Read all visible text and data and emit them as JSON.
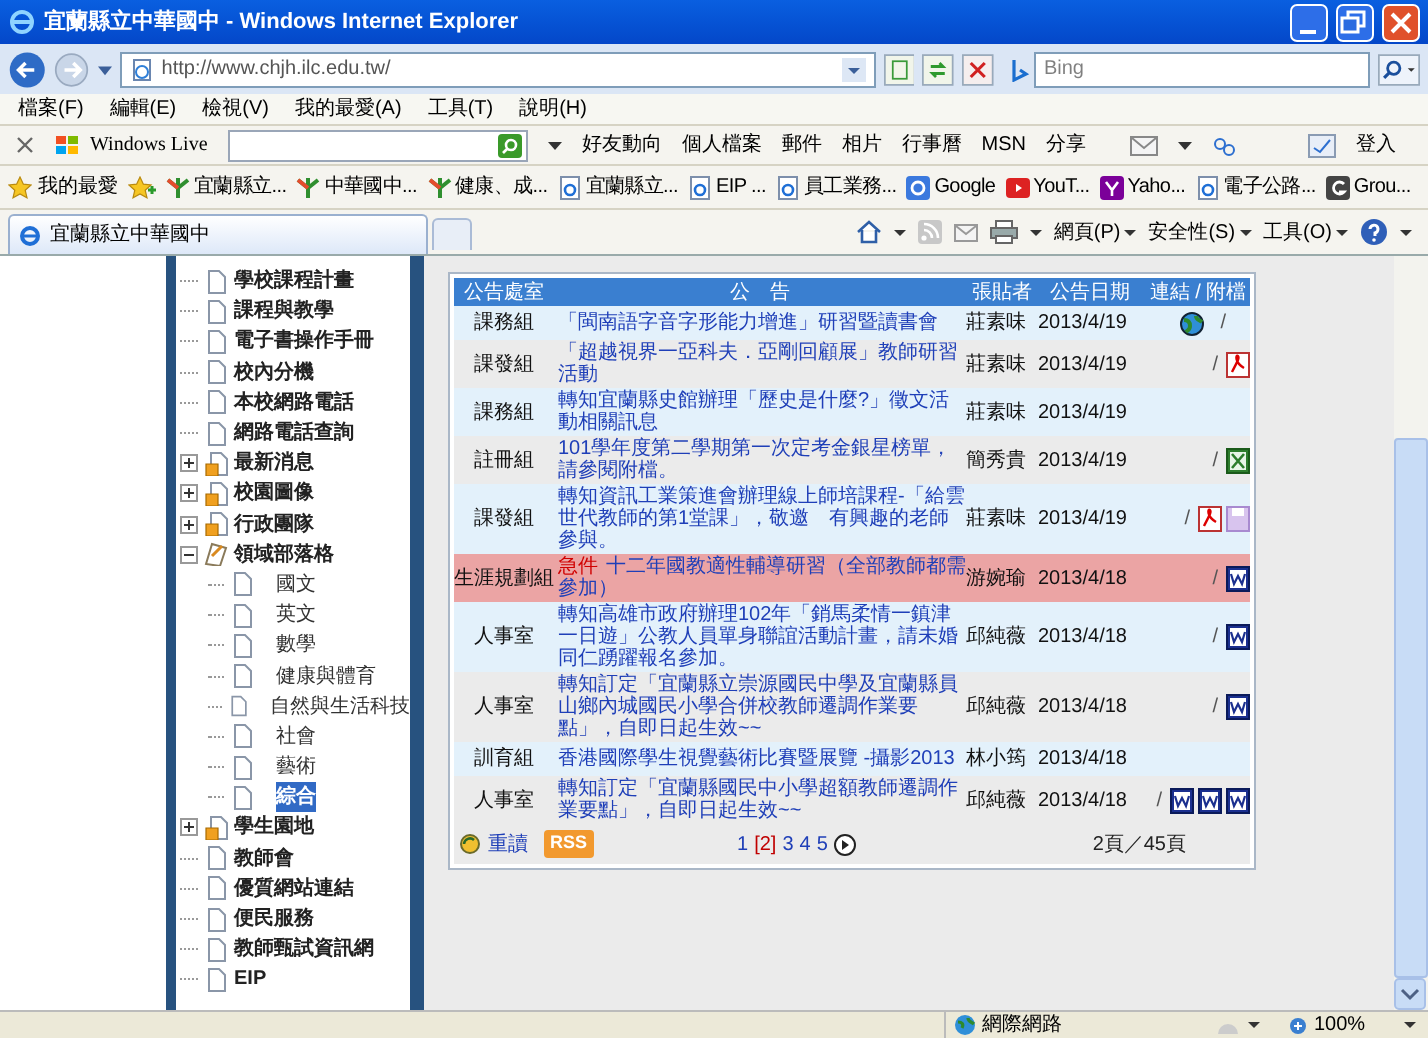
{
  "window": {
    "title": "宜蘭縣立中華國中 - Windows Internet Explorer"
  },
  "address_bar": {
    "url": "http://www.chjh.ilc.edu.tw/",
    "search_placeholder": "Bing"
  },
  "menu": [
    "檔案(F)",
    "編輯(E)",
    "檢視(V)",
    "我的最愛(A)",
    "工具(T)",
    "說明(H)"
  ],
  "live_toolbar": {
    "brand": "Windows Live",
    "links": [
      "好友動向",
      "個人檔案",
      "郵件",
      "相片",
      "行事曆",
      "MSN",
      "分享"
    ],
    "sign_in": "登入"
  },
  "favorites_bar": {
    "label": "我的最愛",
    "items": [
      {
        "label": "宜蘭縣立...",
        "kind": "leaf"
      },
      {
        "label": "中華國中...",
        "kind": "leaf"
      },
      {
        "label": "健康、成...",
        "kind": "leaf"
      },
      {
        "label": "宜蘭縣立...",
        "kind": "page"
      },
      {
        "label": "EIP ...",
        "kind": "page"
      },
      {
        "label": "員工業務...",
        "kind": "page"
      },
      {
        "label": "Google",
        "kind": "google"
      },
      {
        "label": "YouT...",
        "kind": "youtube"
      },
      {
        "label": "Yaho...",
        "kind": "yahoo"
      },
      {
        "label": "電子公路...",
        "kind": "page"
      },
      {
        "label": "Grou...",
        "kind": "grou"
      }
    ]
  },
  "tab": {
    "title": "宜蘭縣立中華國中"
  },
  "command_bar": [
    "網頁(P)",
    "安全性(S)",
    "工具(O)"
  ],
  "sidebar": {
    "items": [
      {
        "label": "學校課程計畫",
        "kind": "page"
      },
      {
        "label": "課程與教學",
        "kind": "page"
      },
      {
        "label": "電子書操作手冊",
        "kind": "page"
      },
      {
        "label": "校內分機",
        "kind": "page"
      },
      {
        "label": "本校網路電話",
        "kind": "page"
      },
      {
        "label": "網路電話查詢",
        "kind": "page"
      },
      {
        "label": "最新消息",
        "kind": "folder",
        "expanded": false
      },
      {
        "label": "校園圖像",
        "kind": "folder",
        "expanded": false
      },
      {
        "label": "行政團隊",
        "kind": "folder",
        "expanded": false
      },
      {
        "label": "領域部落格",
        "kind": "folder",
        "expanded": true,
        "children": [
          {
            "label": "國文",
            "selected": false
          },
          {
            "label": "英文",
            "selected": false
          },
          {
            "label": "數學",
            "selected": false
          },
          {
            "label": "健康與體育",
            "selected": false
          },
          {
            "label": "自然與生活科技",
            "selected": false
          },
          {
            "label": "社會",
            "selected": false
          },
          {
            "label": "藝術",
            "selected": false
          },
          {
            "label": "綜合",
            "selected": true
          }
        ]
      },
      {
        "label": "學生園地",
        "kind": "folder",
        "expanded": false
      },
      {
        "label": "教師會",
        "kind": "page"
      },
      {
        "label": "優質網站連結",
        "kind": "page"
      },
      {
        "label": "便民服務",
        "kind": "page"
      },
      {
        "label": "教師甄試資訊網",
        "kind": "page"
      },
      {
        "label": "EIP",
        "kind": "page"
      }
    ]
  },
  "table": {
    "columns": [
      "公告處室",
      "公　告",
      "張貼者",
      "公告日期",
      "連結 / 附檔"
    ],
    "rows": [
      {
        "unit": "課務組",
        "title": "「閩南語字音字形能力增進」研習暨讀書會",
        "poster": "莊素味",
        "date": "2013/4/19",
        "attachments": [
          {
            "kind": "globe"
          }
        ],
        "separator": "/",
        "urgent": false
      },
      {
        "unit": "課發組",
        "title": "「超越視界一亞科夫．亞剛回顧展」教師研習活動",
        "poster": "莊素味",
        "date": "2013/4/19",
        "separator": "/",
        "attachments": [
          {
            "kind": "pdf"
          }
        ],
        "urgent": false
      },
      {
        "unit": "課務組",
        "title": "轉知宜蘭縣史館辦理「歷史是什麼?」徵文活動相關訊息",
        "poster": "莊素味",
        "date": "2013/4/19",
        "urgent": false
      },
      {
        "unit": "註冊組",
        "title": "101學年度第二學期第一次定考金銀星榜單，請參閱附檔。",
        "poster": "簡秀貴",
        "date": "2013/4/19",
        "separator": "/",
        "attachments": [
          {
            "kind": "excel"
          }
        ],
        "urgent": false
      },
      {
        "unit": "課發組",
        "title": "轉知資訊工業策進會辦理線上師培課程-「給雲世代教師的第1堂課」，敬邀　有興趣的老師參與。",
        "poster": "莊素味",
        "date": "2013/4/19",
        "separator": "/",
        "attachments": [
          {
            "kind": "pdf"
          },
          {
            "kind": "disk"
          }
        ],
        "urgent": false
      },
      {
        "unit": "生涯規劃組",
        "tag": "急件",
        "title": "十二年國教適性輔導研習（全部教師都需參加）",
        "poster": "游婉瑜",
        "date": "2013/4/18",
        "separator": "/",
        "attachments": [
          {
            "kind": "word"
          }
        ],
        "urgent": true
      },
      {
        "unit": "人事室",
        "title": "轉知高雄市政府辦理102年「銷馬柔情一鎮津一日遊」公教人員單身聯誼活動計畫，請未婚同仁踴躍報名參加。",
        "poster": "邱純薇",
        "date": "2013/4/18",
        "separator": "/",
        "attachments": [
          {
            "kind": "word"
          }
        ],
        "urgent": false
      },
      {
        "unit": "人事室",
        "title": "轉知訂定「宜蘭縣立崇源國民中學及宜蘭縣員山鄉內城國民小學合併校教師遷調作業要點」，自即日起生效~~",
        "poster": "邱純薇",
        "date": "2013/4/18",
        "separator": "/",
        "attachments": [
          {
            "kind": "word"
          }
        ],
        "urgent": false
      },
      {
        "unit": "訓育組",
        "title": "香港國際學生視覺藝術比賽暨展覽 -攝影2013",
        "poster": "林小筠",
        "date": "2013/4/18",
        "urgent": false
      },
      {
        "unit": "人事室",
        "title": "轉知訂定「宜蘭縣國民中小學超額教師遷調作業要點」，自即日起生效~~",
        "poster": "邱純薇",
        "date": "2013/4/18",
        "attachments": [
          {
            "kind": "word"
          },
          {
            "kind": "word"
          },
          {
            "kind": "word"
          }
        ],
        "separator": "/",
        "urgent": false
      }
    ],
    "footer": {
      "reload": "重讀",
      "rss": "RSS",
      "pages": [
        {
          "label": "1",
          "selected": false
        },
        {
          "label": "[2]",
          "selected": true
        },
        {
          "label": "3",
          "selected": false
        },
        {
          "label": "4",
          "selected": false
        },
        {
          "label": "5",
          "selected": false
        }
      ],
      "page_count": "2頁／45頁"
    }
  },
  "status_bar": {
    "zone": "網際網路",
    "zoom": "100%"
  }
}
